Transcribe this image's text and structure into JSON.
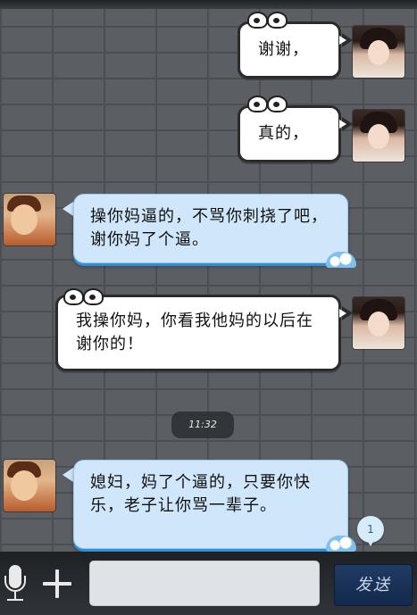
{
  "chat": {
    "messages": [
      {
        "side": "right",
        "text": "谢谢，",
        "style": "white-cartoon"
      },
      {
        "side": "right",
        "text": "真的，",
        "style": "white-cartoon"
      },
      {
        "side": "left",
        "text": "操你妈逼的，不骂你刺挠了吧，  谢你妈了个逼。",
        "style": "blue-wave"
      },
      {
        "side": "right",
        "text": "我操你妈，你看我他妈的以后在谢你的！",
        "style": "white-cartoon"
      },
      {
        "side": "left",
        "text": "媳妇，妈了个逼的，只要你快乐，老子让你骂一辈子。",
        "style": "blue-wave"
      }
    ],
    "timestamp": "11:32",
    "unread_count": "1"
  },
  "bottom_bar": {
    "input_value": "",
    "send_label": "发送"
  },
  "colors": {
    "blue_bubble": "#cfe6fb",
    "white_bubble": "#ffffff",
    "bar": "#1e2124",
    "send_button": "#213b63"
  }
}
